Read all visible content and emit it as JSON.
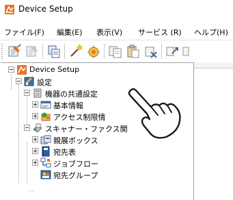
{
  "window": {
    "title": "Device Setup"
  },
  "menu": [
    "ファイル(F)",
    "編集(E)",
    "表示(V)",
    "サービス (R)",
    "ヘルプ(H)"
  ],
  "toolbar": {
    "icons": [
      "register-icon",
      "unregister-icon",
      "properties-icon",
      "wand-icon",
      "wizard-icon",
      "copy-settings-icon",
      "paste-settings-icon",
      "delete-settings-icon",
      "transfer-icon"
    ]
  },
  "tree": {
    "root": "Device Setup",
    "settings": "設定",
    "common": "機器の共通設定",
    "basic": "基本情報",
    "access": "アクセス制限情",
    "scanner": "スキャナー・ファクス関",
    "box": "親展ボックス",
    "address": "宛先表",
    "jobflow": "ジョブフロー",
    "group": "宛先グループ"
  },
  "colors": {
    "accent_orange": "#e8742a",
    "folder_yellow": "#f0c040",
    "selection_blue": "#2e6fbf"
  }
}
